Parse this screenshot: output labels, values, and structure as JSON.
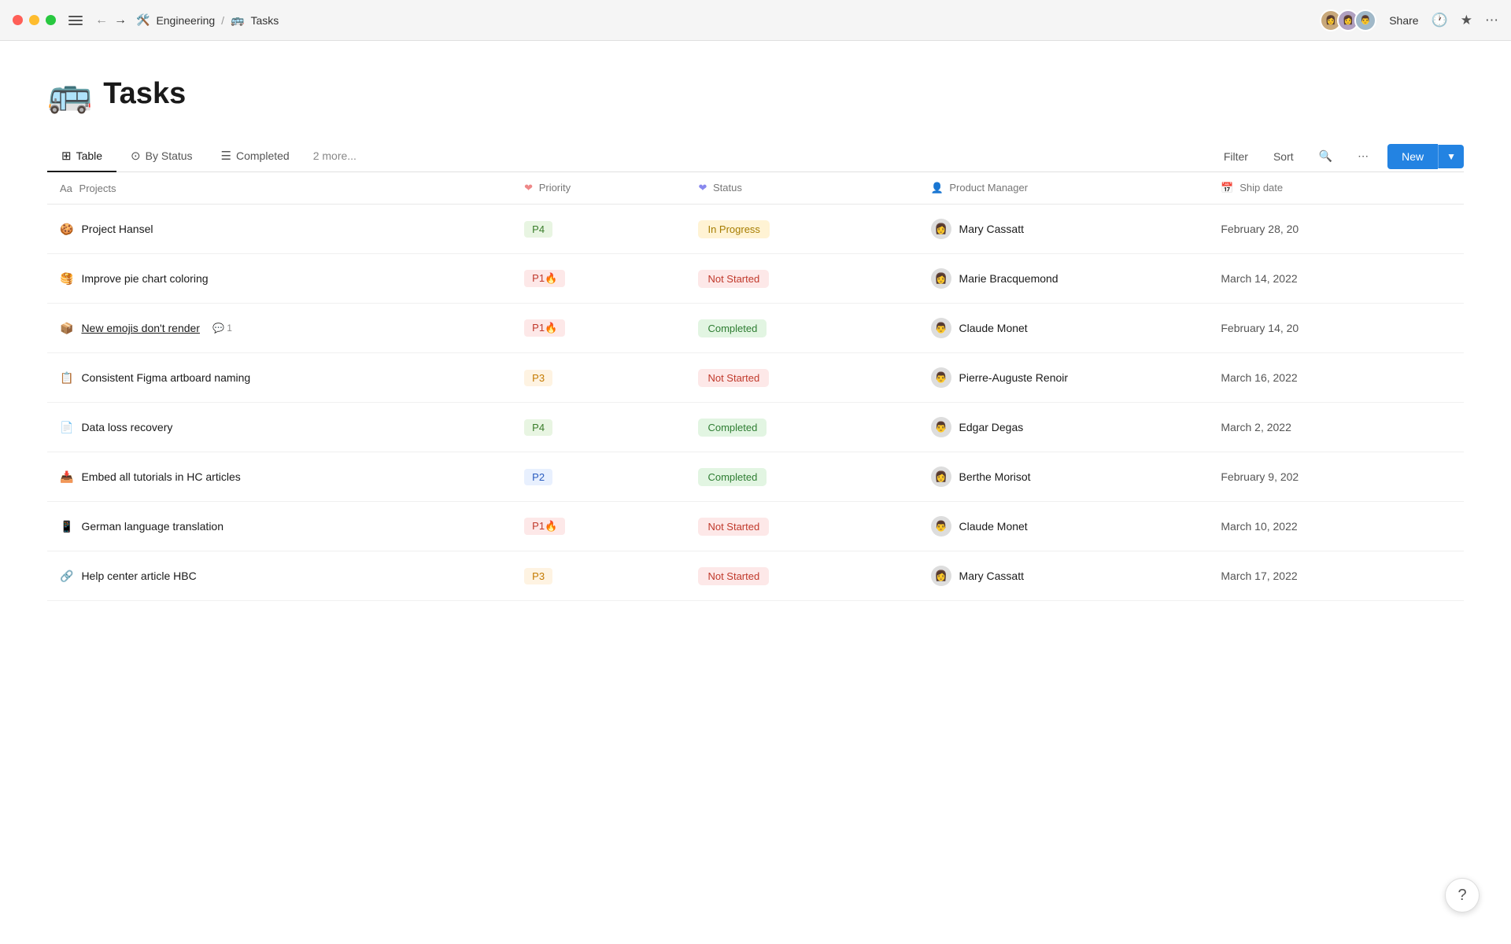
{
  "titlebar": {
    "breadcrumb_icon": "🛠️",
    "breadcrumb_section": "Engineering",
    "breadcrumb_sep": "/",
    "breadcrumb_page_icon": "🚌",
    "breadcrumb_page": "Tasks",
    "share_label": "Share",
    "avatars": [
      "👤",
      "👤",
      "👤"
    ]
  },
  "page": {
    "icon": "🚌",
    "title": "Tasks"
  },
  "tabs": [
    {
      "label": "Table",
      "icon": "⊞",
      "active": true
    },
    {
      "label": "By Status",
      "icon": "⊙",
      "active": false
    },
    {
      "label": "Completed",
      "icon": "☰",
      "active": false
    },
    {
      "label": "2 more...",
      "icon": "",
      "active": false
    }
  ],
  "toolbar": {
    "filter_label": "Filter",
    "sort_label": "Sort",
    "new_label": "New"
  },
  "columns": [
    {
      "label": "Projects",
      "icon": "Aa"
    },
    {
      "label": "Priority",
      "icon": "♡"
    },
    {
      "label": "Status",
      "icon": "♡"
    },
    {
      "label": "Product Manager",
      "icon": "👤"
    },
    {
      "label": "Ship date",
      "icon": "📅"
    }
  ],
  "rows": [
    {
      "icon": "🍪",
      "name": "Project Hansel",
      "underline": false,
      "comment": null,
      "priority": "P4",
      "priority_class": "p-p4",
      "fire": false,
      "status": "In Progress",
      "status_class": "s-inprogress",
      "pm_avatar": "👩",
      "pm_name": "Mary Cassatt",
      "ship_date": "February 28, 20"
    },
    {
      "icon": "🥞",
      "name": "Improve pie chart coloring",
      "underline": false,
      "comment": null,
      "priority": "P1🔥",
      "priority_class": "p-p1",
      "fire": true,
      "status": "Not Started",
      "status_class": "s-notstarted",
      "pm_avatar": "👩",
      "pm_name": "Marie Bracquemond",
      "ship_date": "March 14, 2022"
    },
    {
      "icon": "📦",
      "name": "New emojis don't render",
      "underline": true,
      "comment": "1",
      "priority": "P1🔥",
      "priority_class": "p-p1",
      "fire": true,
      "status": "Completed",
      "status_class": "s-completed",
      "pm_avatar": "👨",
      "pm_name": "Claude Monet",
      "ship_date": "February 14, 20"
    },
    {
      "icon": "📋",
      "name": "Consistent Figma artboard naming",
      "underline": false,
      "comment": null,
      "priority": "P3",
      "priority_class": "p-p3",
      "fire": false,
      "status": "Not Started",
      "status_class": "s-notstarted",
      "pm_avatar": "👨",
      "pm_name": "Pierre-Auguste Renoir",
      "ship_date": "March 16, 2022"
    },
    {
      "icon": "📄",
      "name": "Data loss recovery",
      "underline": false,
      "comment": null,
      "priority": "P4",
      "priority_class": "p-p4",
      "fire": false,
      "status": "Completed",
      "status_class": "s-completed",
      "pm_avatar": "👨",
      "pm_name": "Edgar Degas",
      "ship_date": "March 2, 2022"
    },
    {
      "icon": "📥",
      "name": "Embed all tutorials in HC articles",
      "underline": false,
      "comment": null,
      "priority": "P2",
      "priority_class": "p-p2",
      "fire": false,
      "status": "Completed",
      "status_class": "s-completed",
      "pm_avatar": "👩",
      "pm_name": "Berthe Morisot",
      "ship_date": "February 9, 202"
    },
    {
      "icon": "📱",
      "name": "German language translation",
      "underline": false,
      "comment": null,
      "priority": "P1🔥",
      "priority_class": "p-p1",
      "fire": true,
      "status": "Not Started",
      "status_class": "s-notstarted",
      "pm_avatar": "👨",
      "pm_name": "Claude Monet",
      "ship_date": "March 10, 2022"
    },
    {
      "icon": "🔗",
      "name": "Help center article HBC",
      "underline": false,
      "comment": null,
      "priority": "P3",
      "priority_class": "p-p3",
      "fire": false,
      "status": "Not Started",
      "status_class": "s-notstarted",
      "pm_avatar": "👩",
      "pm_name": "Mary Cassatt",
      "ship_date": "March 17, 2022"
    }
  ],
  "help": "?"
}
